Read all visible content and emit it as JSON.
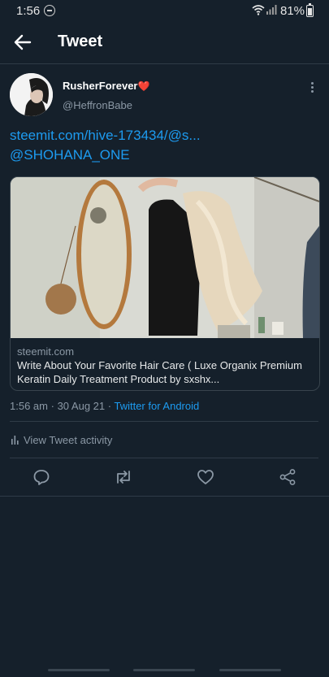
{
  "status_bar": {
    "time": "1:56",
    "battery": "81%"
  },
  "header": {
    "title": "Tweet"
  },
  "tweet": {
    "display_name": "RusherForever",
    "name_emoji": "❤️",
    "handle": "@HeffronBabe",
    "link": "steemit.com/hive-173434/@s...",
    "mention": "@SHOHANA_ONE",
    "card": {
      "domain": "steemit.com",
      "title": "Write About Your Favorite Hair Care ( Luxe Organix Premium Keratin Daily Treatment Product by sxshx..."
    },
    "time": "1:56 am",
    "date": "30 Aug 21",
    "source": "Twitter for Android",
    "activity_label": "View Tweet activity"
  },
  "actions": {
    "reply": "reply-icon",
    "retweet": "retweet-icon",
    "like": "heart-icon",
    "share": "share-icon"
  },
  "colors": {
    "background": "#15202b",
    "accent": "#1d9bf0",
    "secondary_text": "#8b98a5"
  }
}
